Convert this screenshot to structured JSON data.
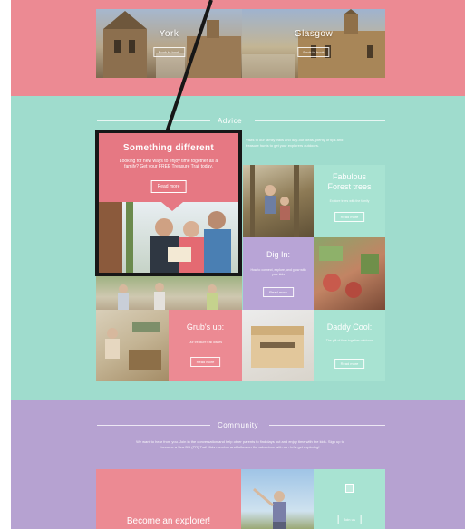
{
  "locations": [
    {
      "name": "York",
      "button": "Book to book"
    },
    {
      "name": "Glasgow",
      "button": "Book to book"
    }
  ],
  "advice": {
    "title": "Advice",
    "intro": "Visits to our family trails and day-out ideas, plenty of tips and treasure hunts to get your explorers outdoors.",
    "featured": {
      "title": "Something different",
      "text": "Looking for new ways to enjoy time together as a family? Get your FREE Treasure Trail today.",
      "button": "Read more"
    },
    "tiles": [
      {
        "title": "Fabulous Forest trees",
        "text": "Explore trees with the family",
        "button": "Read more"
      },
      {
        "title": "Dig In:",
        "text": "How to connect, explore, and grow with your kids",
        "button": "Read more"
      },
      {
        "title": "Grub's up:",
        "text": "Our treasure trail dishes",
        "button": "Read more"
      },
      {
        "title": "Daddy Cool:",
        "text": "The gift of time together outdoors",
        "button": "Read more"
      }
    ]
  },
  "community": {
    "title": "Community",
    "intro": "We want to hear from you. Join in the conversation and help other parents to find days out and enjoy time with the kids. Sign up to become a Sea DU (PR) Trai! Kids member and follow on the adventure with us - let's get exploring!",
    "explorer": "Become an explorer!",
    "button": "Join us"
  },
  "colors": {
    "pink": "#ec8a93",
    "teal": "#9fdccd",
    "purple": "#b6a2d1",
    "callout": "#e67883"
  }
}
